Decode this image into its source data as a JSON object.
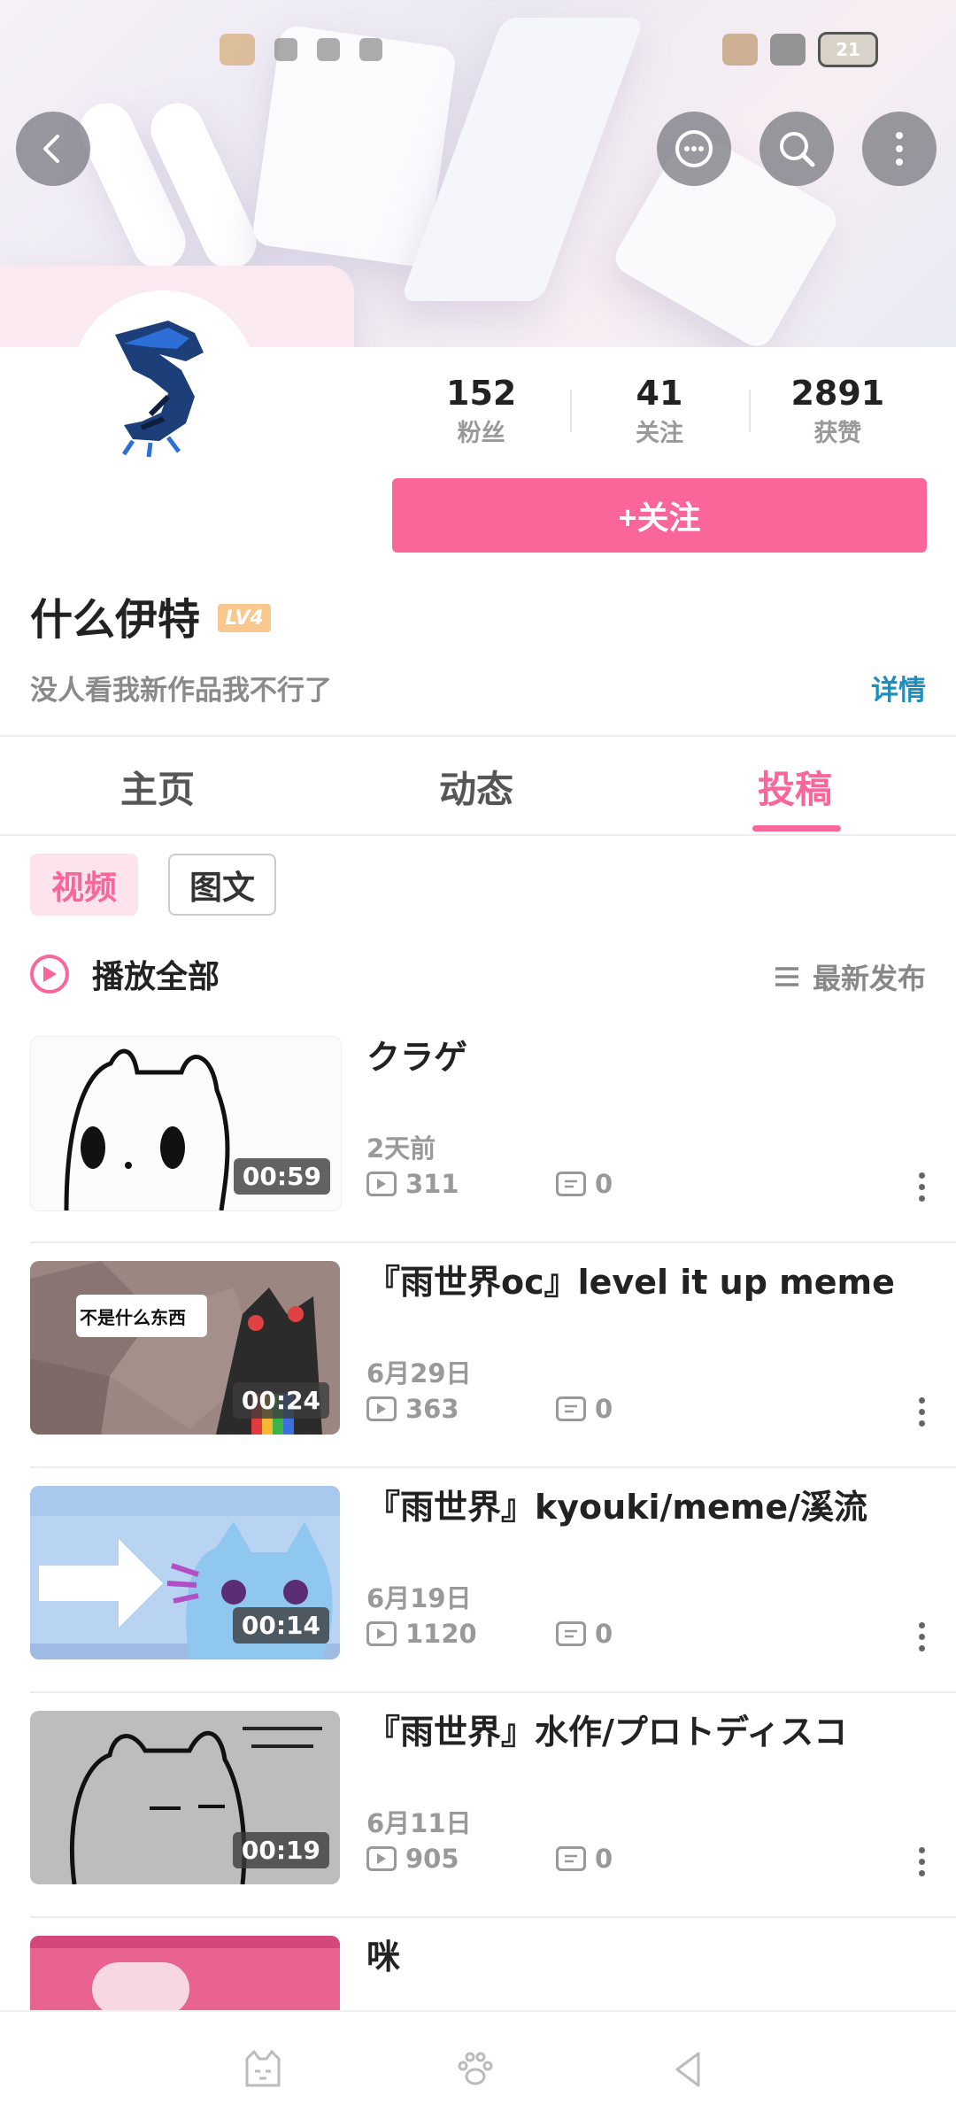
{
  "status_bar": {
    "battery": "21"
  },
  "header": {
    "back_icon": "chevron-left-icon",
    "actions": [
      "chat-bubble-icon",
      "search-icon",
      "more-vertical-icon"
    ]
  },
  "profile": {
    "stats": [
      {
        "value": "152",
        "label": "粉丝"
      },
      {
        "value": "41",
        "label": "关注"
      },
      {
        "value": "2891",
        "label": "获赞"
      }
    ],
    "follow_label": "+关注",
    "name": "什么伊特",
    "level": "LV4",
    "signature": "没人看我新作品我不行了",
    "detail_label": "详情"
  },
  "tabs": [
    {
      "label": "主页",
      "active": false
    },
    {
      "label": "动态",
      "active": false
    },
    {
      "label": "投稿",
      "active": true
    }
  ],
  "filters": [
    {
      "label": "视频",
      "active": true
    },
    {
      "label": "图文",
      "active": false
    }
  ],
  "playall": {
    "label": "播放全部",
    "sort_label": "最新发布"
  },
  "videos": [
    {
      "title": "クラゲ",
      "date": "2天前",
      "views": "311",
      "comments": "0",
      "duration": "00:59"
    },
    {
      "title": "『雨世界oc』level it up meme",
      "date": "6月29日",
      "views": "363",
      "comments": "0",
      "duration": "00:24",
      "overlay_text": "不是什么东西"
    },
    {
      "title": "『雨世界』kyouki/meme/溪流",
      "date": "6月19日",
      "views": "1120",
      "comments": "0",
      "duration": "00:14"
    },
    {
      "title": "『雨世界』水作/プロトディスコ",
      "date": "6月11日",
      "views": "905",
      "comments": "0",
      "duration": "00:19"
    },
    {
      "title": "咪"
    }
  ],
  "colors": {
    "accent": "#fa6699",
    "link": "#1b8fbf"
  }
}
